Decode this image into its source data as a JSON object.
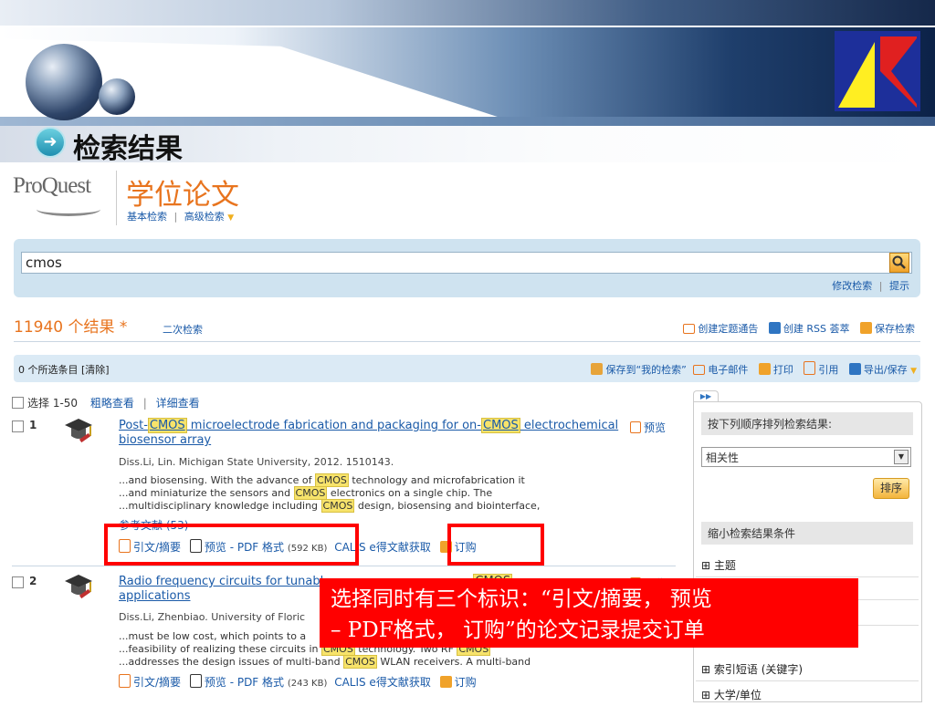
{
  "slide": {
    "title": "检索结果"
  },
  "brand": {
    "logo": "ProQuest",
    "product": "学位论文",
    "basic_search": "基本检索",
    "advanced_search": "高级检索",
    "nav_sep": "|"
  },
  "search": {
    "query": "cmos",
    "modify": "修改检索",
    "tips": "提示",
    "sep": "|"
  },
  "results_bar": {
    "count_label": "11940 个结果 *",
    "refine": "二次检索",
    "create_alert": "创建定题通告",
    "create_rss": "创建 RSS 荟萃",
    "save_search": "保存检索"
  },
  "toolbar": {
    "selected": "0 个所选条目 [清除]",
    "save_my": "保存到“我的检索”",
    "email": "电子邮件",
    "print": "打印",
    "cite": "引用",
    "export": "导出/保存"
  },
  "list_controls": {
    "select_range": "选择 1-50",
    "brief_view": "粗略查看",
    "sep": "|",
    "detail_view": "详细查看"
  },
  "results": [
    {
      "num": "1",
      "title_pre": "Post-",
      "title_hl1": "CMOS",
      "title_mid": " microelectrode fabrication and packaging for on-",
      "title_hl2": "CMOS",
      "title_end": " electrochemical",
      "title_line2": "biosensor array",
      "preview": "预览",
      "meta": "Diss.Li, Lin. Michigan State University, 2012. 1510143.",
      "snip1_pre": "...and biosensing. With the advance of ",
      "snip1_hl": "CMOS",
      "snip1_post": " technology and microfabrication it",
      "snip2_pre": "...and miniaturize the sensors and ",
      "snip2_hl": "CMOS",
      "snip2_post": " electronics on a single chip. The",
      "snip3_pre": "...multidisciplinary knowledge including ",
      "snip3_hl": "CMOS",
      "snip3_post": " design, biosensing and biointerface,",
      "refs": "参考文献 (53)",
      "abstract": "引文/摘要",
      "pdf": "预览 - PDF 格式",
      "pdf_size": "(592 KB)",
      "calis": "CALIS e得文献获取",
      "order": "订购"
    },
    {
      "num": "2",
      "title_visible": "Radio frequency circuits for tunabl",
      "title_hl": "CMOS",
      "title_line2": "applications",
      "preview": "预览",
      "meta": "Diss.Li, Zhenbiao. University of Floric",
      "snip1": "...must be low cost, which points to a",
      "snip2_pre": "...feasibility of realizing these circuits in ",
      "snip2_hl": "CMOS",
      "snip2_mid": " technology. Two RF ",
      "snip2_hl2": "CMOS",
      "snip3_pre": "...addresses the design issues of multi-band ",
      "snip3_hl": "CMOS",
      "snip3_post": " WLAN receivers. A multi-band",
      "abstract": "引文/摘要",
      "pdf": "预览 - PDF 格式",
      "pdf_size": "(243 KB)",
      "calis": "CALIS e得文献获取",
      "order": "订购"
    }
  ],
  "sidebar": {
    "sort_header": "按下列顺序排列检索结果:",
    "sort_value": "相关性",
    "sort_btn": "排序",
    "narrow_header": "缩小检索结果条件",
    "facets": [
      "主题",
      "索引短语 (关键字)",
      "大学/单位"
    ]
  },
  "annotation": {
    "line1": "选择同时有三个标识：“引文/摘要，  预览",
    "line2": "– PDF格式，  订购”的论文记录提交订单"
  },
  "colors": {
    "accent_orange": "#e8741e",
    "link": "#1a5aa8",
    "highlight": "#f7e36b",
    "callout_red": "#ff0000"
  }
}
